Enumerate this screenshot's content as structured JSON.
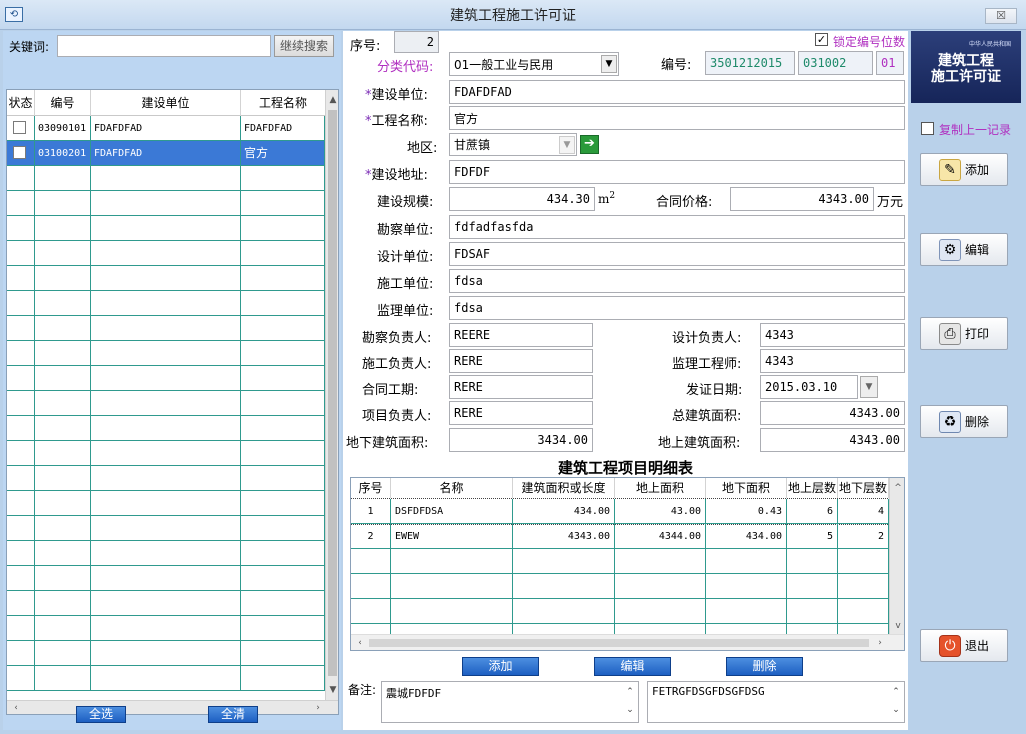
{
  "window": {
    "title": "建筑工程施工许可证",
    "close": "☒"
  },
  "left": {
    "keyword_label": "关键词:",
    "keyword_value": "",
    "search_button": "继续搜索",
    "columns": [
      "状态",
      "编号",
      "建设单位",
      "工程名称"
    ],
    "rows": [
      {
        "code": "03090101",
        "unit": "FDAFDFAD",
        "name": "FDAFDFAD",
        "selected": false
      },
      {
        "code": "03100201",
        "unit": "FDAFDFAD",
        "name": "官方",
        "selected": true
      }
    ],
    "select_all": "全选",
    "clear_all": "全清"
  },
  "form": {
    "seq_label": "序号:",
    "seq_value": "2",
    "lock_label": "锁定编号位数",
    "category_label": "分类代码:",
    "category_value": "01一般工业与民用",
    "number_label": "编号:",
    "number_parts": [
      "3501212015",
      "031002",
      "01"
    ],
    "builder_label": "建设单位:",
    "builder_value": "FDAFDFAD",
    "project_label": "工程名称:",
    "project_value": "官方",
    "region_label": "地区:",
    "region_value": "甘蔗镇",
    "address_label": "建设地址:",
    "address_value": "FDFDF",
    "scale_label": "建设规模:",
    "scale_value": "434.30",
    "scale_unit": "m",
    "scale_sup": "2",
    "price_label": "合同价格:",
    "price_value": "4343.00",
    "price_unit": "万元",
    "survey_unit_label": "勘察单位:",
    "survey_unit_value": "fdfadfasfda",
    "design_unit_label": "设计单位:",
    "design_unit_value": "FDSAF",
    "construct_unit_label": "施工单位:",
    "construct_unit_value": "fdsa",
    "supervise_unit_label": "监理单位:",
    "supervise_unit_value": "fdsa",
    "survey_lead_label": "勘察负责人:",
    "survey_lead_value": "REERE",
    "design_lead_label": "设计负责人:",
    "design_lead_value": "4343",
    "construct_lead_label": "施工负责人:",
    "construct_lead_value": "RERE",
    "engineer_label": "监理工程师:",
    "engineer_value": "4343",
    "period_label": "合同工期:",
    "period_value": "RERE",
    "issue_date_label": "发证日期:",
    "issue_date_value": "2015.03.10",
    "pm_label": "项目负责人:",
    "pm_value": "RERE",
    "total_area_label": "总建筑面积:",
    "total_area_value": "4343.00",
    "under_area_label": "地下建筑面积:",
    "under_area_value": "3434.00",
    "above_area_label": "地上建筑面积:",
    "above_area_value": "4343.00"
  },
  "detail": {
    "title": "建筑工程项目明细表",
    "columns": [
      "序号",
      "名称",
      "建筑面积或长度",
      "地上面积",
      "地下面积",
      "地上层数",
      "地下层数"
    ],
    "rows": [
      [
        "1",
        "DSFDFDSA",
        "434.00",
        "43.00",
        "0.43",
        "6",
        "4"
      ],
      [
        "2",
        "EWEW",
        "4343.00",
        "4344.00",
        "434.00",
        "5",
        "2"
      ]
    ],
    "add": "添加",
    "edit": "编辑",
    "delete": "删除"
  },
  "notes": {
    "label": "备注:",
    "left_value": "震城FDFDF",
    "right_value": "FETRGFDSGFDSGFDSG"
  },
  "right": {
    "book_title_line1": "建筑工程",
    "book_title_line2": "施工许可证",
    "book_header": "中华人民共和国",
    "copy_label": "复制上一记录",
    "add": "添加",
    "edit": "编辑",
    "print": "打印",
    "delete": "删除",
    "exit": "退出"
  }
}
